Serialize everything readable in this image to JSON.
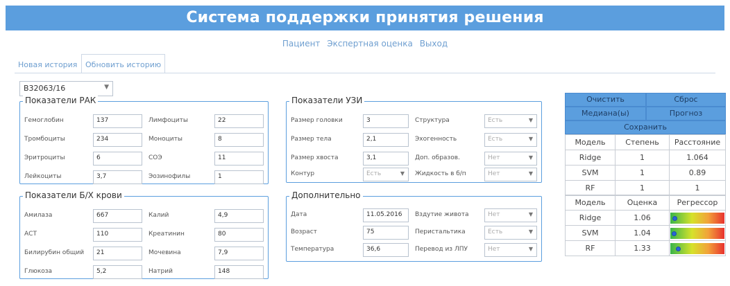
{
  "header": {
    "title": "Система поддержки принятия решения"
  },
  "nav": [
    "Пациент",
    "Экспертная оценка",
    "Выход"
  ],
  "tabs": [
    "Новая история",
    "Обновить историю"
  ],
  "history_select": {
    "value": "B32063/16"
  },
  "rak": {
    "title": "Показатели РАК",
    "left": [
      {
        "label": "Гемоглобин",
        "value": "137"
      },
      {
        "label": "Тромбоциты",
        "value": "234"
      },
      {
        "label": "Эритроциты",
        "value": "6"
      },
      {
        "label": "Лейкоциты",
        "value": "3,7"
      }
    ],
    "right": [
      {
        "label": "Лимфоциты",
        "value": "22"
      },
      {
        "label": "Моноциты",
        "value": "8"
      },
      {
        "label": "СОЭ",
        "value": "11"
      },
      {
        "label": "Эозинофилы",
        "value": "1"
      }
    ]
  },
  "bio": {
    "title": "Показатели Б/Х крови",
    "left": [
      {
        "label": "Амилаза",
        "value": "667"
      },
      {
        "label": "АСТ",
        "value": "110"
      },
      {
        "label": "Билирубин общий",
        "value": "21"
      },
      {
        "label": "Глюкоза",
        "value": "5,2"
      }
    ],
    "right": [
      {
        "label": "Калий",
        "value": "4,9"
      },
      {
        "label": "Креатинин",
        "value": "80"
      },
      {
        "label": "Мочевина",
        "value": "7,9"
      },
      {
        "label": "Натрий",
        "value": "148"
      }
    ]
  },
  "uzi": {
    "title": "Показатели УЗИ",
    "left": [
      {
        "label": "Размер головки",
        "value": "3"
      },
      {
        "label": "Размер тела",
        "value": "2,1"
      },
      {
        "label": "Размер хвоста",
        "value": "3,1"
      },
      {
        "label": "Контур",
        "value": "Есть"
      }
    ],
    "right": [
      {
        "label": "Структура",
        "value": "Есть"
      },
      {
        "label": "Эхогенность",
        "value": "Есть"
      },
      {
        "label": "Доп. образов.",
        "value": "Нет"
      },
      {
        "label": "Жидкость в б/п",
        "value": "Нет"
      }
    ]
  },
  "extra": {
    "title": "Дополнительно",
    "left": [
      {
        "label": "Дата",
        "value": "11.05.2016"
      },
      {
        "label": "Возраст",
        "value": "75"
      },
      {
        "label": "Температура",
        "value": "36,6"
      }
    ],
    "right": [
      {
        "label": "Вздутие живота",
        "value": "Нет"
      },
      {
        "label": "Перистальтика",
        "value": "Есть"
      },
      {
        "label": "Перевод из ЛПУ",
        "value": "Нет"
      }
    ]
  },
  "actions": {
    "clear": "Очистить",
    "reset": "Сброс",
    "median": "Медиана(ы)",
    "forecast": "Прогноз",
    "save": "Сохранить"
  },
  "models_table": {
    "headers": [
      "Модель",
      "Степень",
      "Расстояние"
    ],
    "rows": [
      [
        "Ridge",
        "1",
        "1.064"
      ],
      [
        "SVM",
        "1",
        "0.89"
      ],
      [
        "RF",
        "1",
        "1"
      ]
    ]
  },
  "score_table": {
    "headers": [
      "Модель",
      "Оценка",
      "Регрессор"
    ],
    "rows": [
      {
        "model": "Ridge",
        "score": "1.06",
        "regressor_level": 0.05
      },
      {
        "model": "SVM",
        "score": "1.04",
        "regressor_level": 0.03
      },
      {
        "model": "RF",
        "score": "1.33",
        "regressor_level": 0.12
      }
    ]
  },
  "colors": {
    "accent": "#5b9ede",
    "link": "#6f9fd0",
    "heat_low": "#39b54a",
    "heat_mid": "#d6e22b",
    "heat_high": "#e8322f",
    "marker": "#2a65d8"
  }
}
